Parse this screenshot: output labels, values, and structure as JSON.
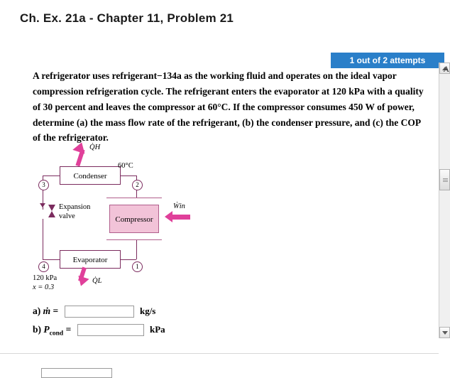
{
  "page": {
    "title": "Ch. Ex. 21a - Chapter 11, Problem 21",
    "attempt_badge": "1 out of 2 attempts",
    "badge_color": "#2a7fc9",
    "problem_text": "A refrigerator uses refrigerant−134a as the working fluid and operates on the ideal vapor compression refrigeration cycle. The refrigerant enters the evaporator at 120 kPa with a quality of 30 percent and leaves the compressor at 60°C. If the compressor consumes 450 W of power, determine (a) the mass flow rate of the refrigerant, (b) the condenser pressure, and (c) the COP of the refrigerator.",
    "edge_letter": "A"
  },
  "diagram": {
    "condenser_label": "Condenser",
    "evaporator_label": "Evaporator",
    "compressor_label": "Compressor",
    "expansion_valve_label_line1": "Expansion",
    "expansion_valve_label_line2": "valve",
    "qh_label": "Q̇H",
    "ql_label": "Q̇L",
    "win_label": "Ẇin",
    "temp_label": "60°C",
    "state_1": "1",
    "state_2": "2",
    "state_3": "3",
    "state_4": "4",
    "inlet_pressure": "120 kPa",
    "inlet_quality": "x = 0.3",
    "accent_color": "#e0409a",
    "line_color": "#7b2b5e",
    "compressor_fill": "#f2c3d8"
  },
  "answers": [
    {
      "letter": "a)",
      "symbol": "ṁ",
      "subscript": "",
      "equals": "=",
      "value": "",
      "placeholder": "",
      "unit": "kg/s"
    },
    {
      "letter": "b)",
      "symbol": "P",
      "subscript": "cond",
      "equals": "=",
      "value": "",
      "placeholder": "",
      "unit": "kPa"
    }
  ],
  "scrollbar": {
    "up_arrow": "scroll-up",
    "down_arrow": "scroll-down",
    "thumb": "scroll-thumb"
  }
}
